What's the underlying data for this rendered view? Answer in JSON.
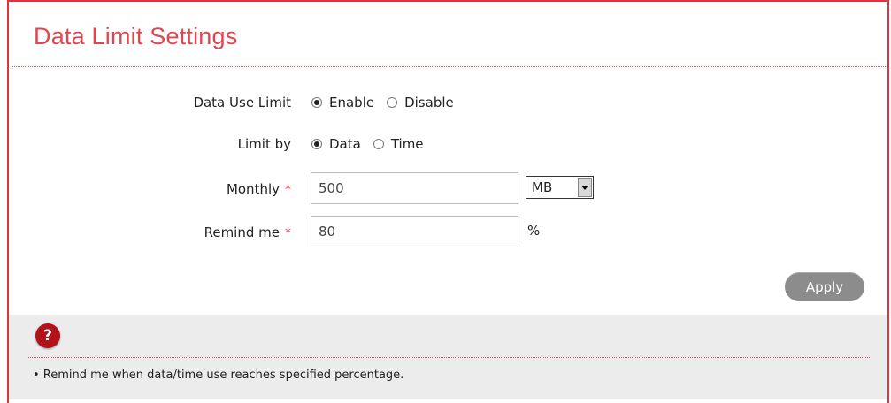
{
  "page": {
    "title": "Data Limit Settings"
  },
  "form": {
    "data_use_limit": {
      "label": "Data Use Limit",
      "options": [
        {
          "label": "Enable",
          "checked": true
        },
        {
          "label": "Disable",
          "checked": false
        }
      ]
    },
    "limit_by": {
      "label": "Limit by",
      "options": [
        {
          "label": "Data",
          "checked": true
        },
        {
          "label": "Time",
          "checked": false
        }
      ]
    },
    "monthly": {
      "label": "Monthly",
      "required_mark": "*",
      "value": "500",
      "unit_select": "MB"
    },
    "remind_me": {
      "label": "Remind me",
      "required_mark": "*",
      "value": "80",
      "unit": "%"
    },
    "apply_label": "Apply"
  },
  "help": {
    "icon": "question-icon",
    "icon_glyph": "?",
    "text": "• Remind me when data/time use reaches specified percentage."
  },
  "colors": {
    "accent": "#e0464e",
    "border": "#e0343c",
    "help_bg": "#ececec",
    "button": "#8c8c8c"
  }
}
